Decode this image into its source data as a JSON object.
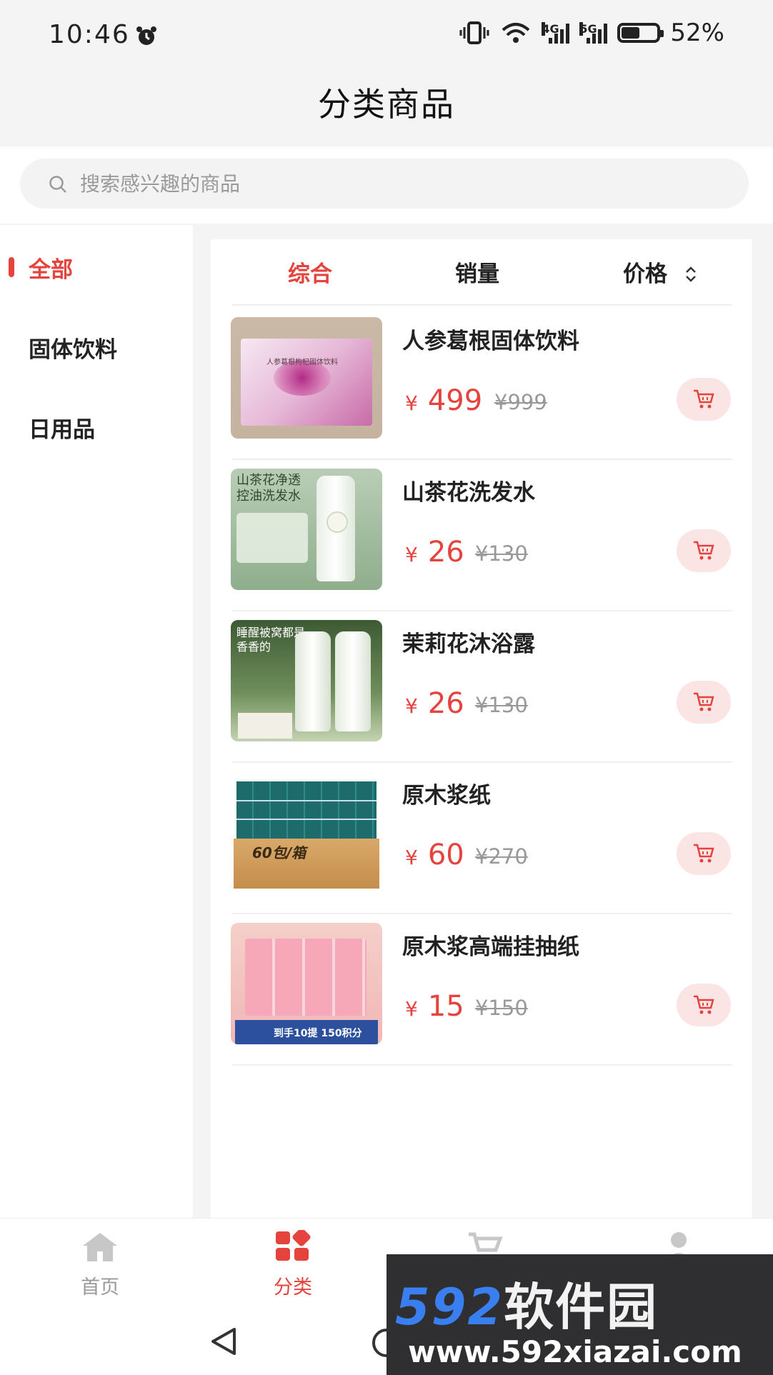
{
  "status_bar": {
    "time": "10:46",
    "net1": "4G",
    "net2": "5G",
    "battery": "52%",
    "battery_level": 0.52
  },
  "header": {
    "title": "分类商品"
  },
  "search": {
    "placeholder": "搜索感兴趣的商品"
  },
  "sidebar": {
    "items": [
      {
        "label": "全部",
        "active": true
      },
      {
        "label": "固体饮料"
      },
      {
        "label": "日用品"
      }
    ]
  },
  "sort": {
    "tabs": [
      {
        "label": "综合",
        "active": true
      },
      {
        "label": "销量"
      },
      {
        "label": "价格"
      }
    ]
  },
  "products": [
    {
      "name": "人参葛根固体饮料",
      "currency": "¥",
      "price": "499",
      "original": "¥999",
      "thumb_text": "人参葛根枸杞固体饮料"
    },
    {
      "name": "山茶花洗发水",
      "currency": "¥",
      "price": "26",
      "original": "¥130",
      "thumb_text": "山茶花净透\n控油洗发水"
    },
    {
      "name": "茉莉花沐浴露",
      "currency": "¥",
      "price": "26",
      "original": "¥130",
      "thumb_text": "睡醒被窝都是\n香香的"
    },
    {
      "name": "原木浆纸",
      "currency": "¥",
      "price": "60",
      "original": "¥270",
      "thumb_text": "60包/箱"
    },
    {
      "name": "原木浆高端挂抽纸",
      "currency": "¥",
      "price": "15",
      "original": "¥150",
      "thumb_text": "到手10提 150积分"
    }
  ],
  "bottom_nav": {
    "items": [
      {
        "label": "首页",
        "icon": "home-icon"
      },
      {
        "label": "分类",
        "icon": "category-icon",
        "active": true
      },
      {
        "label": "",
        "icon": "cart-icon"
      },
      {
        "label": "",
        "icon": "user-icon"
      }
    ]
  },
  "watermark": {
    "brand": "592",
    "brand_cn": "软件园",
    "url": "www.592xiazai.com"
  },
  "colors": {
    "accent": "#e5433e",
    "cart_bg": "#fbe4e4"
  }
}
